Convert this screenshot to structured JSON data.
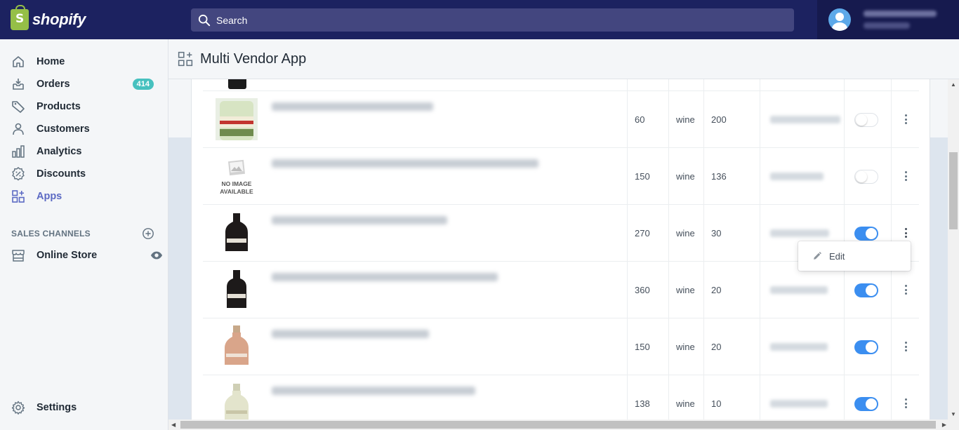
{
  "topbar": {
    "brand": "shopify",
    "search_placeholder": "Search"
  },
  "sidebar": {
    "items": [
      {
        "label": "Home",
        "icon": "home-icon"
      },
      {
        "label": "Orders",
        "icon": "orders-icon",
        "badge": "414"
      },
      {
        "label": "Products",
        "icon": "tag-icon"
      },
      {
        "label": "Customers",
        "icon": "person-icon"
      },
      {
        "label": "Analytics",
        "icon": "bar-chart-icon"
      },
      {
        "label": "Discounts",
        "icon": "discount-icon"
      },
      {
        "label": "Apps",
        "icon": "apps-icon",
        "active": true
      }
    ],
    "sales_channels_heading": "SALES CHANNELS",
    "online_store": "Online Store",
    "settings": "Settings"
  },
  "header": {
    "title": "Multi Vendor App"
  },
  "table": {
    "rows": [
      {
        "qty": "60",
        "type": "wine",
        "price": "200",
        "enabled": false,
        "image": "white-wine-bottle"
      },
      {
        "qty": "150",
        "type": "wine",
        "price": "136",
        "enabled": false,
        "image": "no-image",
        "no_image_line1": "NO IMAGE",
        "no_image_line2": "AVAILABLE"
      },
      {
        "qty": "270",
        "type": "wine",
        "price": "30",
        "enabled": true,
        "image": "dark-wine-bottle"
      },
      {
        "qty": "360",
        "type": "wine",
        "price": "20",
        "enabled": true,
        "image": "dark-wine-bottle"
      },
      {
        "qty": "150",
        "type": "wine",
        "price": "20",
        "enabled": true,
        "image": "rose-wine-bottle"
      },
      {
        "qty": "138",
        "type": "wine",
        "price": "10",
        "enabled": true,
        "image": "light-wine-bottle"
      }
    ]
  },
  "popover": {
    "edit_label": "Edit"
  },
  "colors": {
    "topbar": "#1c2260",
    "accent": "#5c6ac4",
    "toggle_on": "#3b8ef0",
    "badge": "#47c1bf"
  }
}
